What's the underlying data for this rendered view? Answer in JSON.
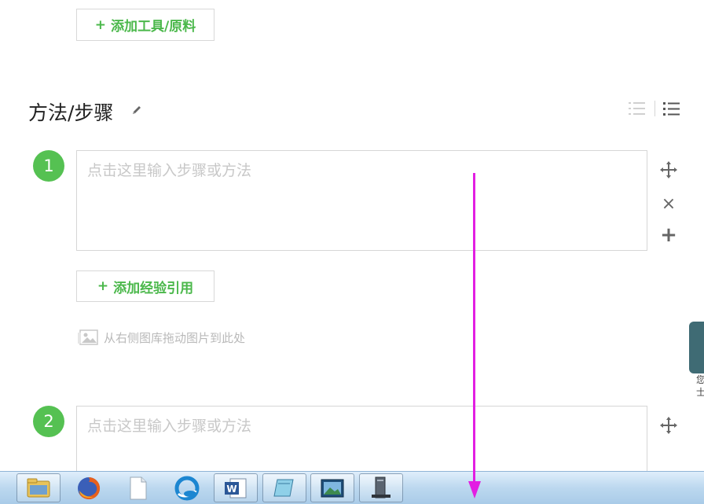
{
  "tools": {
    "add_label": "添加工具/原料",
    "plus": "+"
  },
  "section": {
    "title": "方法/步骤"
  },
  "steps": [
    {
      "number": "1",
      "placeholder": "点击这里输入步骤或方法"
    },
    {
      "number": "2",
      "placeholder": "点击这里输入步骤或方法"
    }
  ],
  "experience": {
    "add_label": "添加经验引用",
    "plus": "+"
  },
  "image_hint": {
    "text": "从右侧图库拖动图片到此处"
  },
  "side_tab": {
    "text": "您士"
  },
  "step_actions": {
    "close": "×",
    "add": "+"
  },
  "colors": {
    "accent": "#55c152",
    "arrow": "#e21ee2"
  },
  "taskbar": {
    "items": [
      {
        "name": "file-explorer"
      },
      {
        "name": "firefox"
      },
      {
        "name": "blank-document"
      },
      {
        "name": "browser"
      },
      {
        "name": "word"
      },
      {
        "name": "notepad"
      },
      {
        "name": "image-viewer"
      },
      {
        "name": "computer"
      }
    ]
  }
}
